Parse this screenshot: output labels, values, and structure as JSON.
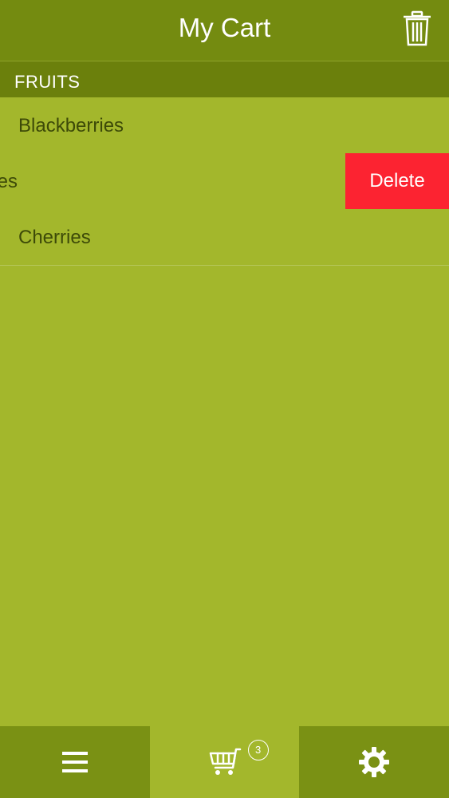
{
  "header": {
    "title": "My Cart",
    "trash_icon": "trash-icon"
  },
  "section": {
    "title": "FRUITS"
  },
  "items": [
    {
      "label": "Blackberries"
    },
    {
      "label": "Blueberries",
      "swiped": true,
      "action_label": "Delete"
    },
    {
      "label": "Cherries"
    }
  ],
  "tabbar": {
    "tabs": [
      {
        "icon": "menu-icon",
        "active": false
      },
      {
        "icon": "cart-icon",
        "active": true,
        "badge": "3"
      },
      {
        "icon": "gear-icon",
        "active": false
      }
    ]
  },
  "colors": {
    "background": "#a3b72c",
    "header": "#748b10",
    "section_header": "#6b800c",
    "tabbar": "#7a9114",
    "delete": "#fc2331",
    "item_text": "#3d4a08"
  }
}
